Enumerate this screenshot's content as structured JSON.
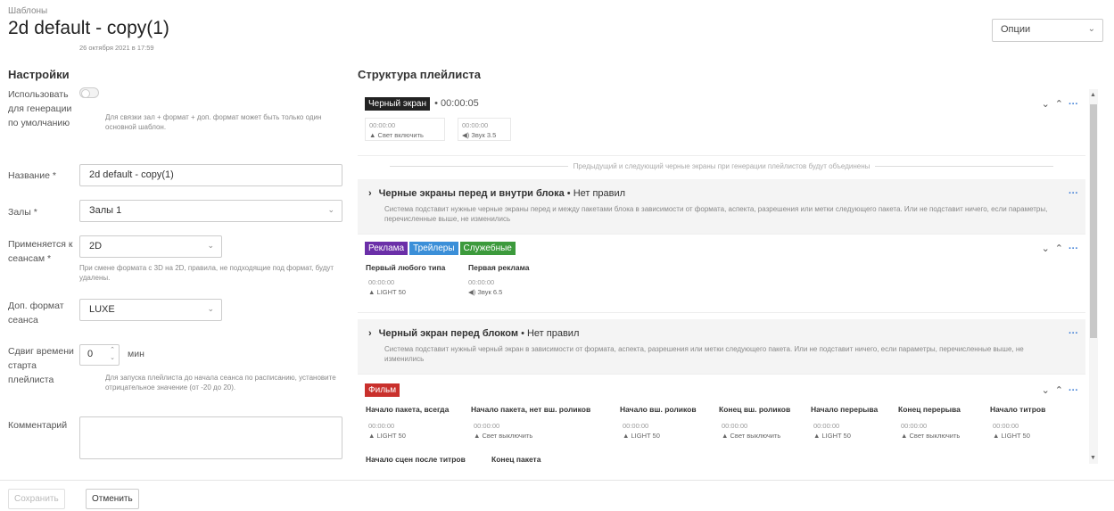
{
  "header": {
    "breadcrumb": "Шаблоны",
    "title": "2d default - copy(1)",
    "date": "26 октября 2021 в 17:59",
    "options_label": "Опции"
  },
  "settings": {
    "heading": "Настройки",
    "use_label": "Использовать для генерации по умолчанию",
    "use_hint": "Для связки зал + формат + доп. формат может быть только один основной шаблон.",
    "name_label": "Название *",
    "name_value": "2d default - copy(1)",
    "halls_label": "Залы *",
    "halls_value": "Залы 1",
    "applies_label": "Применяется к сеансам *",
    "applies_value": "2D",
    "applies_hint": "При смене формата с 3D на 2D, правила, не подходящие под формат, будут удалены.",
    "extra_label": "Доп. формат сеанса",
    "extra_value": "LUXE",
    "shift_label": "Сдвиг времени старта плейлиста",
    "shift_value": "0",
    "shift_unit": "мин",
    "shift_hint": "Для запуска плейлиста до начала сеанса по расписанию, установите отрицательное значение (от -20 до 20).",
    "comment_label": "Комментарий"
  },
  "footer": {
    "save": "Сохранить",
    "cancel": "Отменить"
  },
  "structure": {
    "heading": "Структура плейлиста",
    "block1": {
      "tag": "Черный экран",
      "duration": "• 00:00:05",
      "c1_time": "00:00:00",
      "c1_val": "Свет включить",
      "c2_time": "00:00:00",
      "c2_val": "Звук 3.5"
    },
    "merge_note": "Предыдущий и следующий черные экраны при генерации плейлистов будут объединены",
    "rule1": {
      "title": "Черные экраны перед и внутри блока",
      "status": "• Нет правил",
      "desc": "Система подставит нужные черные экраны перед и между пакетами блока в зависимости от формата, аспекта, разрешения или метки следующего пакета. Или не подставит ничего, если параметры, перечисленные выше, не изменились"
    },
    "block2": {
      "tags": [
        "Реклама",
        "Трейлеры",
        "Служебные"
      ],
      "col1": "Первый любого типа",
      "col2": "Первая реклама",
      "c1_time": "00:00:00",
      "c1_val": "LIGHT 50",
      "c2_time": "00:00:00",
      "c2_val": "Звук 6.5"
    },
    "rule2": {
      "title": "Черный экран перед блоком",
      "status": "• Нет правил",
      "desc": "Система подставит нужный черный экран в зависимости от формата, аспекта, разрешения или метки следующего пакета. Или не подставит ничего, если параметры, перечисленные выше, не изменились"
    },
    "block3": {
      "tag": "Фильм",
      "cols": [
        "Начало пакета, всегда",
        "Начало пакета, нет вш. роликов",
        "Начало вш. роликов",
        "Конец вш. роликов",
        "Начало перерыва",
        "Конец перерыва",
        "Начало титров"
      ],
      "times": [
        "00:00:00",
        "00:00:00",
        "00:00:00",
        "00:00:00",
        "00:00:00",
        "00:00:00",
        "00:00:00"
      ],
      "vals": [
        "LIGHT 50",
        "Свет выключить",
        "LIGHT 50",
        "Свет выключить",
        "LIGHT 50",
        "Свет выключить",
        "LIGHT 50"
      ],
      "row2": [
        "Начало сцен после титров",
        "Конец пакета"
      ]
    }
  },
  "colors": {
    "black_tag": "#222222",
    "ads_tag": "#6b2fa8",
    "trailers_tag": "#3b8fd8",
    "service_tag": "#3c9a3c",
    "film_tag": "#c9302c",
    "link": "#3a7bd5"
  }
}
